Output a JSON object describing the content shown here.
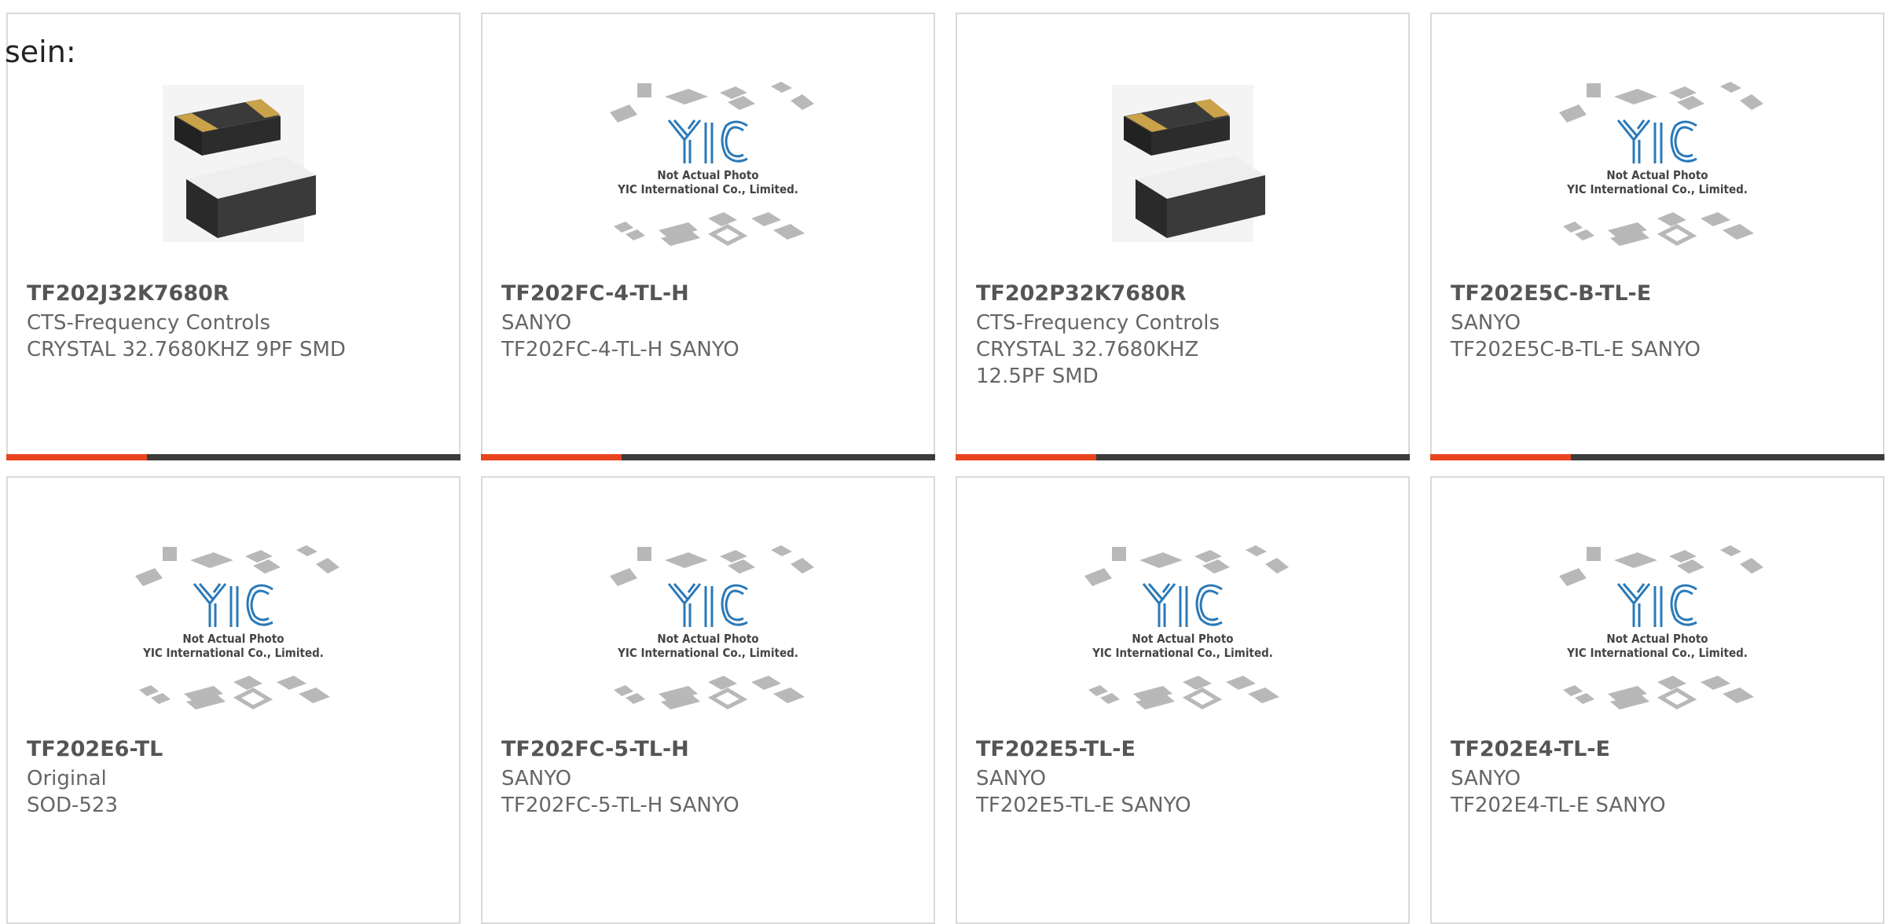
{
  "lead_text": "sein:",
  "colors": {
    "accent": "#e8441f",
    "bar": "#3c3c3c",
    "border": "#dadada",
    "logo": "#2a79b8"
  },
  "placeholder": {
    "line1": "Not Actual Photo",
    "line2": "YIC International Co., Limited."
  },
  "products": [
    {
      "part": "TF202J32K7680R",
      "manufacturer": "CTS-Frequency Controls",
      "description": "CRYSTAL 32.7680KHZ 9PF SMD",
      "image": "crystal-photo",
      "progress": 0.31
    },
    {
      "part": "TF202FC-4-TL-H",
      "manufacturer": "SANYO",
      "description": "TF202FC-4-TL-H SANYO",
      "image": "placeholder",
      "progress": 0.31
    },
    {
      "part": "TF202P32K7680R",
      "manufacturer": "CTS-Frequency Controls",
      "description": "CRYSTAL 32.7680KHZ 12.5PF SMD",
      "image": "crystal-photo",
      "progress": 0.31
    },
    {
      "part": "TF202E5C-B-TL-E",
      "manufacturer": "SANYO",
      "description": "TF202E5C-B-TL-E SANYO",
      "image": "placeholder",
      "progress": 0.31
    },
    {
      "part": "TF202E6-TL",
      "manufacturer": "Original",
      "description": "SOD-523",
      "image": "placeholder"
    },
    {
      "part": "TF202FC-5-TL-H",
      "manufacturer": "SANYO",
      "description": "TF202FC-5-TL-H SANYO",
      "image": "placeholder"
    },
    {
      "part": "TF202E5-TL-E",
      "manufacturer": "SANYO",
      "description": "TF202E5-TL-E SANYO",
      "image": "placeholder"
    },
    {
      "part": "TF202E4-TL-E",
      "manufacturer": "SANYO",
      "description": "TF202E4-TL-E SANYO",
      "image": "placeholder"
    }
  ]
}
